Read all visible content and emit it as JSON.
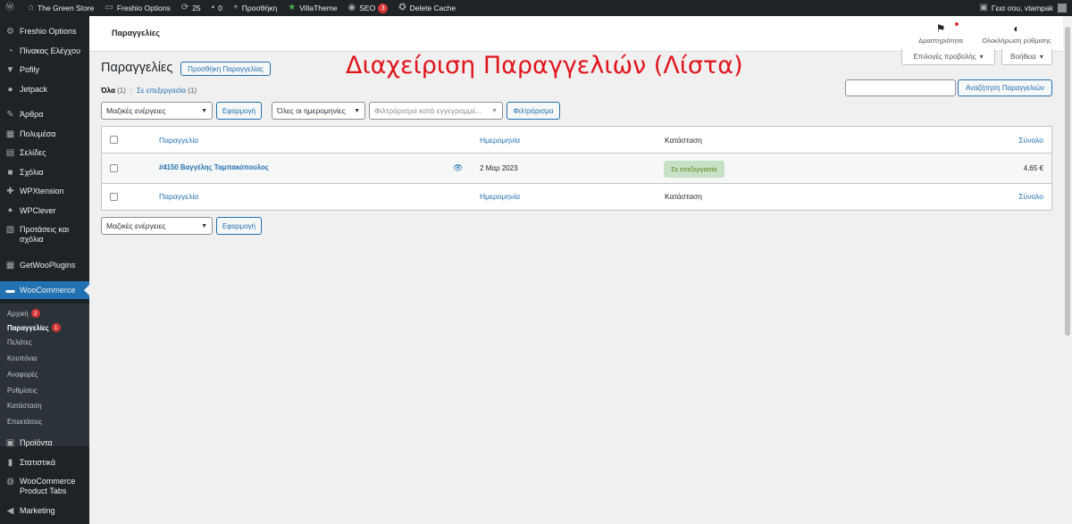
{
  "admin_bar": {
    "site_name": "The Green Store",
    "freshio_options": "Freshio Options",
    "updates_count": "25",
    "comments_count": "0",
    "new_label": "Προσθήκη",
    "villatheme": "VillaTheme",
    "seo_label": "SEO",
    "seo_count": "3",
    "delete_cache": "Delete Cache",
    "greeting": "Γεια σου, vtampak"
  },
  "sidebar": {
    "items": [
      {
        "label": "Freshio Options",
        "icon": "gear-icon"
      },
      {
        "label": "Πίνακας Ελέγχου",
        "icon": "dashboard-icon"
      },
      {
        "label": "Pofily",
        "icon": "filter-icon"
      },
      {
        "label": "Jetpack",
        "icon": "jetpack-icon"
      },
      {
        "label": "Άρθρα",
        "icon": "pin-icon"
      },
      {
        "label": "Πολυμέσα",
        "icon": "media-icon"
      },
      {
        "label": "Σελίδες",
        "icon": "page-icon"
      },
      {
        "label": "Σχόλια",
        "icon": "comment-icon"
      },
      {
        "label": "WPXtension",
        "icon": "plugin-icon"
      },
      {
        "label": "WPClever",
        "icon": "bulb-icon"
      },
      {
        "label": "Προτάσεις και σχόλια",
        "icon": "feedback-icon"
      },
      {
        "label": "GetWooPlugins",
        "icon": "grid-icon"
      },
      {
        "label": "WooCommerce",
        "icon": "woo-icon"
      },
      {
        "label": "Προϊόντα",
        "icon": "archive-icon"
      },
      {
        "label": "Στατιστικά",
        "icon": "chart-icon"
      },
      {
        "label": "WooCommerce Product Tabs",
        "icon": "globe-icon"
      },
      {
        "label": "Marketing",
        "icon": "megaphone-icon"
      }
    ],
    "submenu": [
      {
        "label": "Αρχική",
        "count": "2"
      },
      {
        "label": "Παραγγελίες",
        "count": "1"
      },
      {
        "label": "Πελάτες"
      },
      {
        "label": "Κουπόνια"
      },
      {
        "label": "Αναφορές"
      },
      {
        "label": "Ρυθμίσεις"
      },
      {
        "label": "Κατάσταση"
      },
      {
        "label": "Επεκτάσεις"
      }
    ]
  },
  "header": {
    "title": "Παραγγελίες",
    "activity": "Δραστηριότητα",
    "finish_setup": "Ολοκλήρωση ρύθμισης"
  },
  "screen_options": {
    "view_options": "Επιλογές προβολής",
    "help": "Βοήθεια"
  },
  "page": {
    "heading": "Παραγγελίες",
    "add_order": "Προσθήκη Παραγγελίας",
    "overlay_title": "Διαχείριση Παραγγελιών (Λίστα)"
  },
  "views": {
    "all_label": "Όλα",
    "all_count": "(1)",
    "separator": "|",
    "processing_label": "Σε επεξεργασία",
    "processing_count": "(1)"
  },
  "search": {
    "value": "",
    "button": "Αναζήτηση Παραγγελιών"
  },
  "filters": {
    "bulk_actions": "Μαζικές ενέργειες",
    "apply": "Εφαρμογή",
    "all_dates": "Όλες οι ημερομηνίες",
    "customer_placeholder": "Φιλτράρισμα κατά εγγεγραμμέ...",
    "filter_button": "Φιλτράρισμα"
  },
  "table": {
    "columns": {
      "order": "Παραγγελία",
      "date": "Ημερομηνία",
      "status": "Κατάσταση",
      "total": "Σύνολο"
    },
    "rows": [
      {
        "order": "#4150 Βαγγέλης Ταμπακόπουλος",
        "date": "2 Μαρ 2023",
        "status": "Σε επεξεργασία",
        "total": "4,65 €"
      }
    ]
  },
  "colors": {
    "accent": "#2271b1",
    "admin_dark": "#1d2327",
    "overlay_red": "#e0151b",
    "status_processing_bg": "#c6e1c6",
    "status_processing_text": "#5b841b"
  }
}
